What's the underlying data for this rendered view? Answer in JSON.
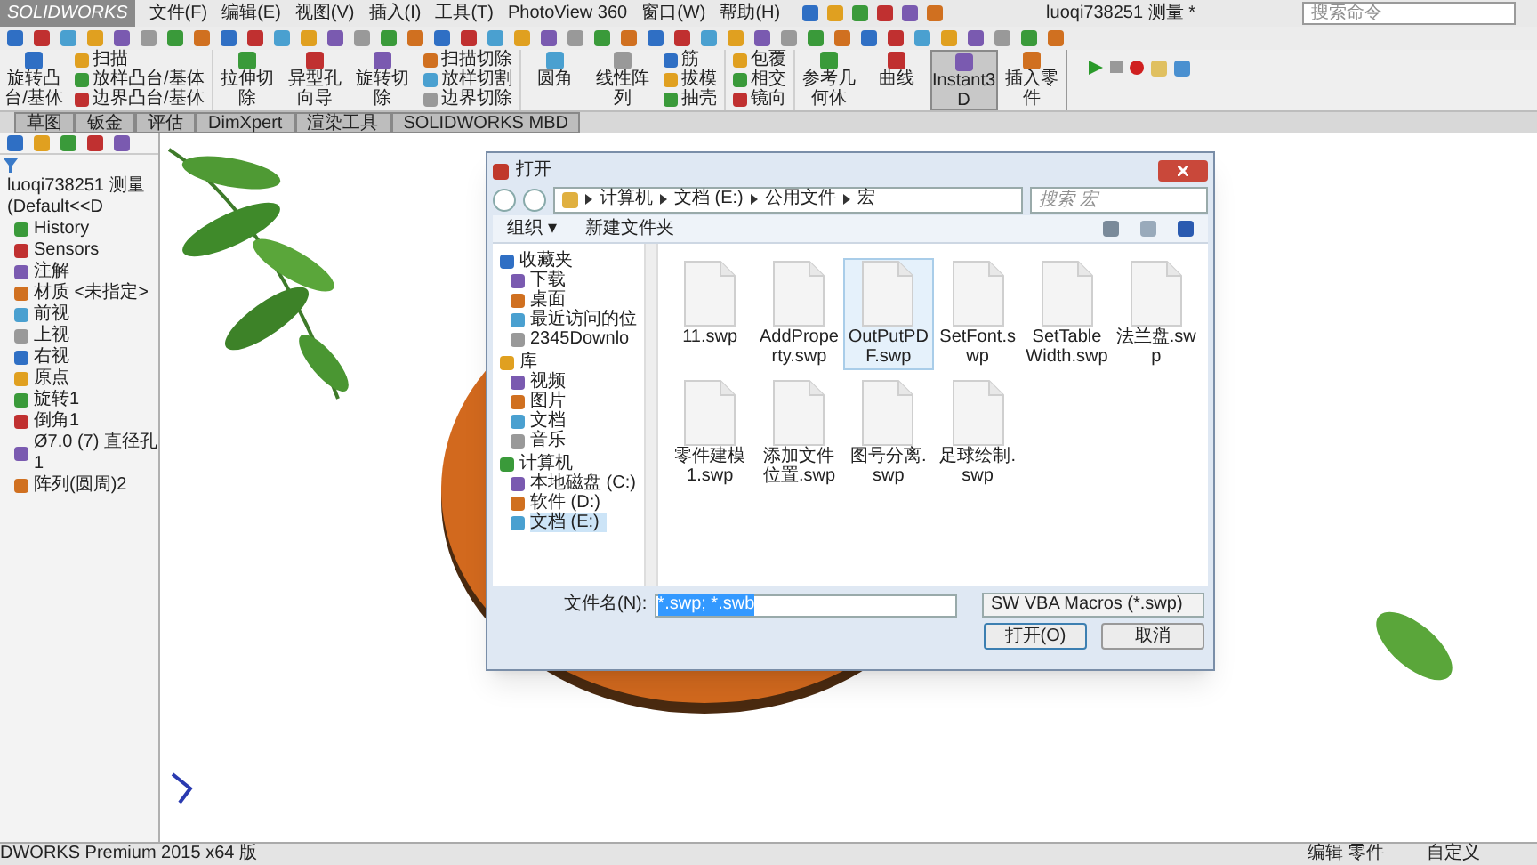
{
  "menu_bar": {
    "logo": "SOLIDWORKS",
    "items": [
      "文件(F)",
      "编辑(E)",
      "视图(V)",
      "插入(I)",
      "工具(T)",
      "PhotoView 360",
      "窗口(W)",
      "帮助(H)"
    ],
    "title": "luoqi738251 测量 *",
    "search": {
      "placeholder": "搜索命令"
    }
  },
  "command_manager": {
    "groups": [
      {
        "kind": "large",
        "label": "旋转凸台/基体",
        "selected": false
      },
      {
        "kind": "stack",
        "items": [
          "扫描",
          "放样凸台/基体",
          "边界凸台/基体"
        ]
      },
      {
        "kind": "large",
        "label": "拉伸切除",
        "selected": false
      },
      {
        "kind": "large",
        "label": "异型孔向导",
        "selected": false
      },
      {
        "kind": "large",
        "label": "旋转切除",
        "selected": false
      },
      {
        "kind": "stack",
        "items": [
          "扫描切除",
          "放样切割",
          "边界切除"
        ]
      },
      {
        "kind": "large",
        "label": "圆角",
        "selected": false
      },
      {
        "kind": "large",
        "label": "线性阵列",
        "selected": false
      },
      {
        "kind": "stack",
        "items": [
          "筋",
          "拔模",
          "抽壳"
        ]
      },
      {
        "kind": "stack",
        "items": [
          "包覆",
          "相交",
          "镜向"
        ]
      },
      {
        "kind": "large",
        "label": "参考几何体",
        "selected": false
      },
      {
        "kind": "large",
        "label": "曲线",
        "selected": false
      },
      {
        "kind": "large",
        "label": "Instant3D",
        "selected": true
      },
      {
        "kind": "large",
        "label": "插入零件",
        "selected": false
      }
    ]
  },
  "tabs": [
    {
      "label": "草图",
      "selected": false
    },
    {
      "label": "钣金",
      "selected": false
    },
    {
      "label": "评估",
      "selected": false
    },
    {
      "label": "DimXpert",
      "selected": false
    },
    {
      "label": "渲染工具",
      "selected": false
    },
    {
      "label": "SOLIDWORKS MBD",
      "selected": false
    }
  ],
  "feature_tree": {
    "root": "luoqi738251 测量  (Default<<D",
    "items": [
      "History",
      "Sensors",
      "注解",
      "材质 <未指定>",
      "前视",
      "上视",
      "右视",
      "原点",
      "旋转1",
      "倒角1",
      "Ø7.0 (7) 直径孔1",
      "阵列(圆周)2"
    ]
  },
  "dialog": {
    "title": "打开",
    "path": [
      "计算机",
      "文档 (E:)",
      "公用文件",
      "宏"
    ],
    "search": {
      "placeholder": "搜索 宏"
    },
    "toolbar": [
      "组织 ▾",
      "新建文件夹"
    ],
    "nav": [
      {
        "label": "收藏夹",
        "selected": false,
        "children": [
          {
            "label": "下载",
            "selected": false
          },
          {
            "label": "桌面",
            "selected": false
          },
          {
            "label": "最近访问的位",
            "selected": false
          },
          {
            "label": "2345Downlo",
            "selected": false
          }
        ]
      },
      {
        "label": "库",
        "selected": false,
        "children": [
          {
            "label": "视频",
            "selected": false
          },
          {
            "label": "图片",
            "selected": false
          },
          {
            "label": "文档",
            "selected": false
          },
          {
            "label": "音乐",
            "selected": false
          }
        ]
      },
      {
        "label": "计算机",
        "selected": false,
        "children": [
          {
            "label": "本地磁盘 (C:)",
            "selected": false
          },
          {
            "label": "软件 (D:)",
            "selected": false
          },
          {
            "label": "文档 (E:)",
            "selected": true
          }
        ]
      }
    ],
    "files": [
      {
        "name": "11.swp",
        "selected": false
      },
      {
        "name": "AddProperty.swp",
        "selected": false
      },
      {
        "name": "OutPutPDF.swp",
        "selected": true
      },
      {
        "name": "SetFont.swp",
        "selected": false
      },
      {
        "name": "SetTableWidth.swp",
        "selected": false
      },
      {
        "name": "法兰盘.swp",
        "selected": false
      },
      {
        "name": "零件建模1.swp",
        "selected": false
      },
      {
        "name": "添加文件位置.swp",
        "selected": false
      },
      {
        "name": "图号分离.swp",
        "selected": false
      },
      {
        "name": "足球绘制.swp",
        "selected": false
      }
    ],
    "filename_label": "文件名(N):",
    "filename": "*.swp; *.swb",
    "filter": "SW VBA Macros (*.swp)",
    "buttons": [
      "打开(O)",
      "取消"
    ]
  },
  "status_bar": {
    "left": "DWORKS Premium 2015 x64 版",
    "mode": "编辑 零件",
    "units": "自定义"
  }
}
